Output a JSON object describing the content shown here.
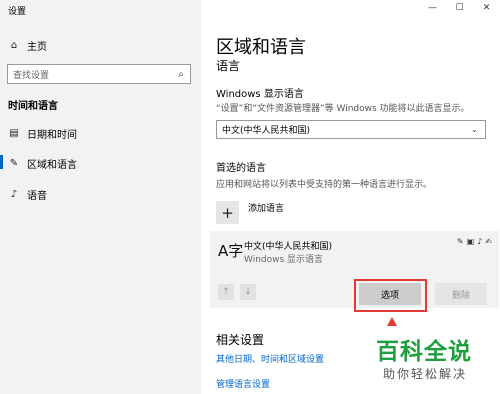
{
  "app": {
    "title": "设置"
  },
  "window_controls": {
    "minimize": "—",
    "maximize": "☐",
    "close": "✕"
  },
  "nav": {
    "home_label": "主页",
    "search_placeholder": "查找设置",
    "section_label": "时间和语言",
    "items": [
      {
        "label": "日期和时间",
        "icon": "calendar-icon"
      },
      {
        "label": "区域和语言",
        "icon": "region-language-icon",
        "active": true
      },
      {
        "label": "语音",
        "icon": "microphone-icon"
      }
    ]
  },
  "main": {
    "title": "区域和语言",
    "subtitle": "语言",
    "display_language": {
      "heading": "Windows 显示语言",
      "description": "“设置”和“文件资源管理器”等 Windows 功能将以此语言显示。",
      "selected": "中文(中华人民共和国)"
    },
    "preferred": {
      "heading": "首选的语言",
      "description": "应用和网站将以列表中受支持的第一种语言进行显示。",
      "add_label": "添加语言",
      "language": {
        "glyph": "A字",
        "name": "中文(中华人民共和国)",
        "sub": "Windows 显示语言"
      },
      "options_button": "选项",
      "remove_button": "删除"
    },
    "related": {
      "heading": "相关设置",
      "links": [
        "其他日期、时间和区域设置",
        "管理语言设置"
      ]
    }
  },
  "watermark": {
    "title": "百科全说",
    "subtitle": "助你轻松解决"
  },
  "colors": {
    "accent": "#0067c0",
    "highlight": "#e53935",
    "watermark": "#1f9e3e",
    "link": "#0066cc"
  }
}
